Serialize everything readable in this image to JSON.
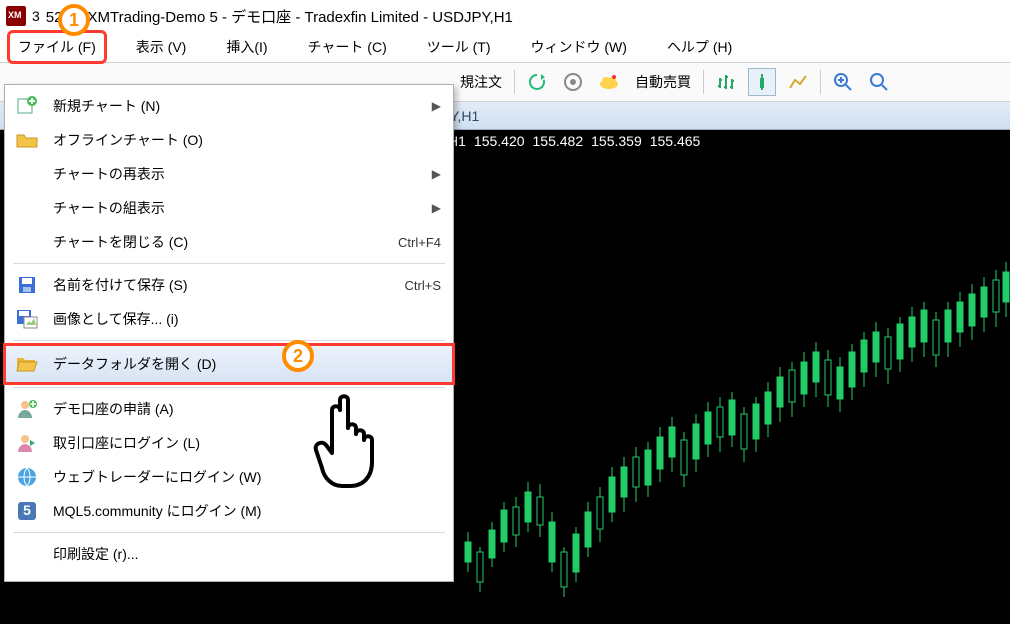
{
  "title_prefix": "3",
  "title_suffix": "5273: XMTrading-Demo 5 - デモ口座 - Tradexfin Limited - USDJPY,H1",
  "menubar": {
    "file": "ファイル (F)",
    "view": "表示 (V)",
    "insert": "挿入(I)",
    "chart": "チャート (C)",
    "tool": "ツール (T)",
    "window": "ウィンドウ (W)",
    "help": "ヘルプ (H)"
  },
  "toolbar": {
    "new_order": "規注文",
    "auto_trade": "自動売買"
  },
  "chart_tab": "Y,H1",
  "chart_info": {
    "symbol": "H1",
    "v1": "155.420",
    "v2": "155.482",
    "v3": "155.359",
    "v4": "155.465"
  },
  "file_menu": {
    "new_chart": "新規チャート (N)",
    "offline_chart": "オフラインチャート (O)",
    "redisplay": "チャートの再表示",
    "multi": "チャートの組表示",
    "close": "チャートを閉じる (C)",
    "close_sc": "Ctrl+F4",
    "saveas": "名前を付けて保存 (S)",
    "saveas_sc": "Ctrl+S",
    "saveimg": "画像として保存... (i)",
    "datafolder": "データフォルダを開く (D)",
    "demo": "デモ口座の申請 (A)",
    "login": "取引口座にログイン (L)",
    "webtrader": "ウェブトレーダーにログイン (W)",
    "mql5": "MQL5.community にログイン (M)",
    "print_setup": "印刷設定 (r)..."
  },
  "badges": {
    "one": "1",
    "two": "2"
  }
}
